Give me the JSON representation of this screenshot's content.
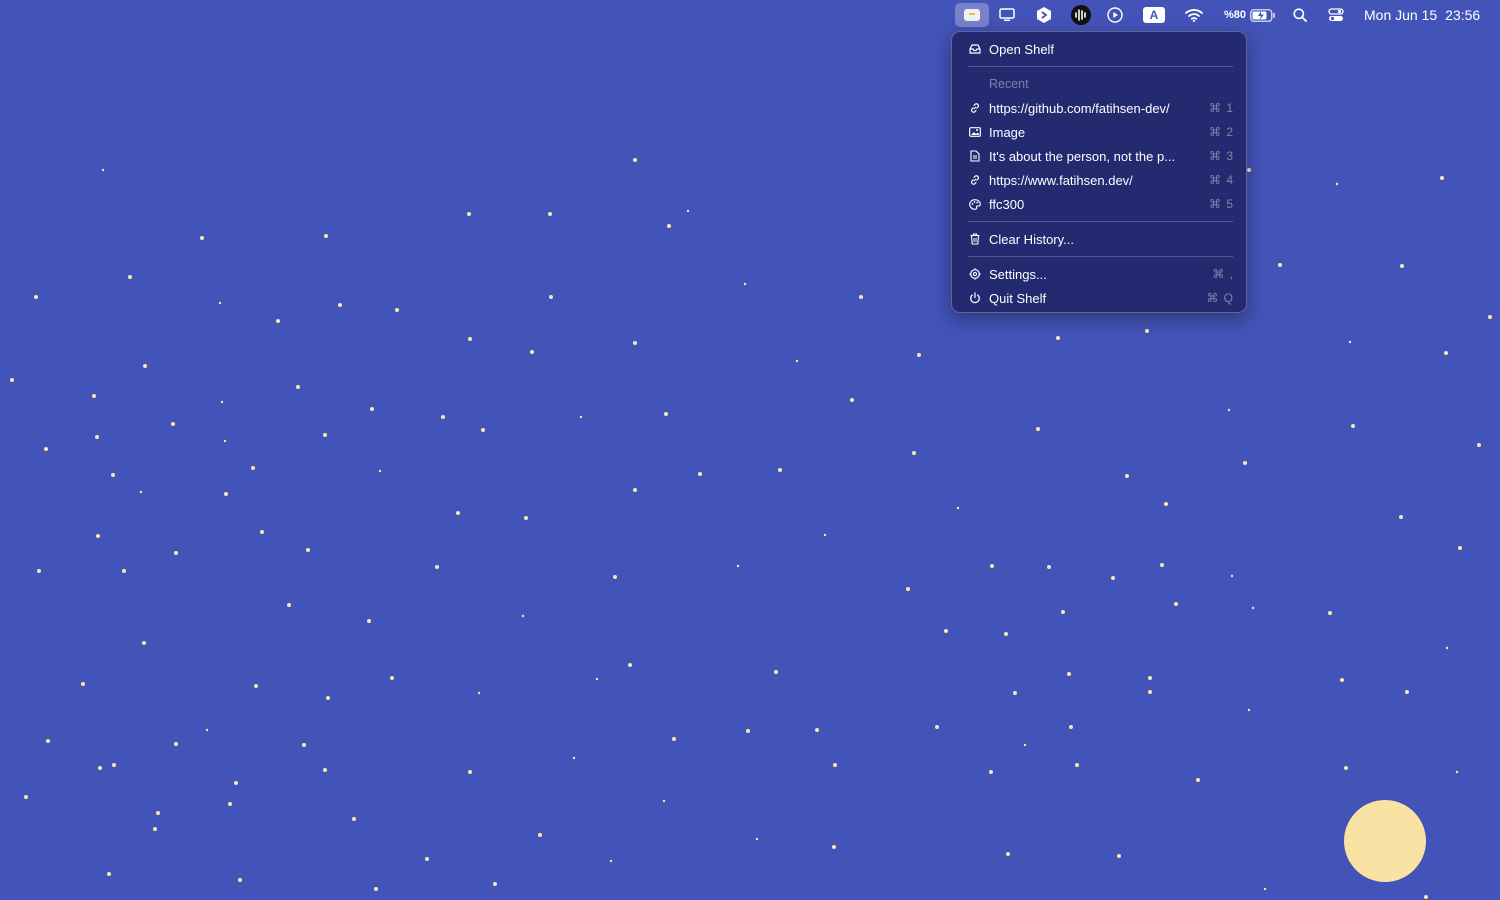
{
  "menubar": {
    "battery_text": "%80",
    "date": "Mon Jun 15",
    "time": "23:56",
    "keyboard_input_label": "A",
    "icons": [
      "shelf-app-icon",
      "display-icon",
      "arc-icon",
      "audio-waveform-icon",
      "play-circle-icon",
      "input-source-icon",
      "wifi-icon",
      "battery-icon",
      "search-icon",
      "control-center-icon"
    ]
  },
  "menu": {
    "open_label": "Open Shelf",
    "recent_header": "Recent",
    "recent_items": [
      {
        "label": "https://github.com/fatihsen-dev/",
        "shortcut": "⌘ 1",
        "icon": "link-icon"
      },
      {
        "label": "Image",
        "shortcut": "⌘ 2",
        "icon": "image-icon"
      },
      {
        "label": "It's about the person, not the p...",
        "shortcut": "⌘ 3",
        "icon": "document-icon"
      },
      {
        "label": "https://www.fatihsen.dev/",
        "shortcut": "⌘ 4",
        "icon": "link-icon"
      },
      {
        "label": "ffc300",
        "shortcut": "⌘ 5",
        "icon": "palette-icon"
      }
    ],
    "clear_label": "Clear History...",
    "settings_label": "Settings...",
    "settings_shortcut": "⌘ ,",
    "quit_label": "Quit Shelf",
    "quit_shortcut": "⌘ Q"
  },
  "colors": {
    "desktop": "#4353b7",
    "menu_bg": "#232a70",
    "star": "#f9e7b0",
    "moon": "#f9e2a3"
  }
}
